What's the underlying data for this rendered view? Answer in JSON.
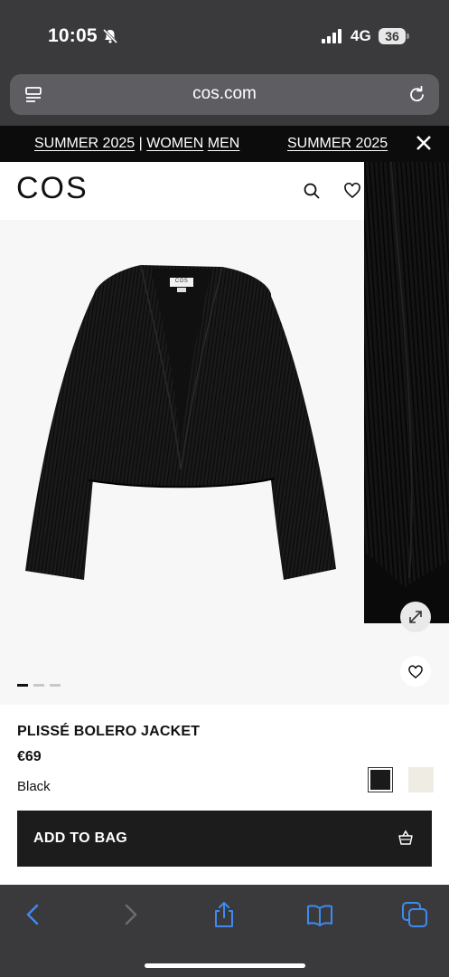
{
  "status_bar": {
    "time": "10:05",
    "network": "4G",
    "battery": "36"
  },
  "browser": {
    "url": "cos.com"
  },
  "promo": {
    "link1": "SUMMER 2025",
    "sep": "|",
    "link2": "WOMEN",
    "link3": "MEN",
    "link4": "SUMMER 2025"
  },
  "header": {
    "logo": "COS"
  },
  "product": {
    "name": "PLISSÉ BOLERO JACKET",
    "price": "€69",
    "color": "Black",
    "garment_label": "COS",
    "swatches": [
      "#1a1a1a",
      "#efece3"
    ],
    "add_to_bag": "ADD TO BAG",
    "gallery_index": 1,
    "gallery_count": 3
  },
  "colors": {
    "toolbar": "#3a3a3c",
    "accent_blue": "#3d8bf2",
    "button": "#1c1c1c"
  }
}
